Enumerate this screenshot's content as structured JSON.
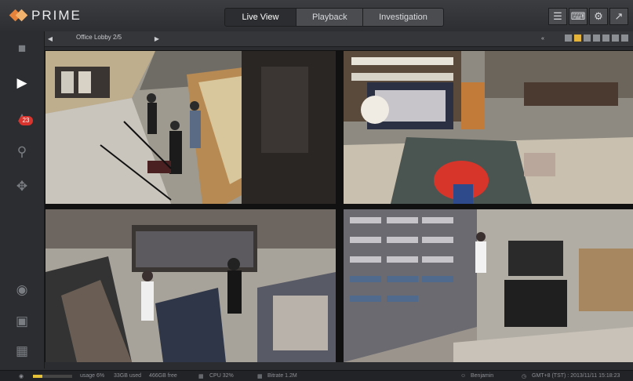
{
  "app": {
    "logo_text": "PRIME"
  },
  "tabs": [
    {
      "label": "Live View",
      "active": true
    },
    {
      "label": "Playback",
      "active": false
    },
    {
      "label": "Investigation",
      "active": false
    }
  ],
  "top_icons": [
    "menu-icon",
    "keyboard-icon",
    "gear-icon",
    "expand-icon"
  ],
  "sidebar": [
    {
      "name": "folder-icon"
    },
    {
      "name": "live-camera-icon",
      "active": true
    },
    {
      "name": "alarm-icon",
      "badge": "23"
    },
    {
      "name": "search-icon"
    },
    {
      "name": "ptz-icon"
    },
    {
      "name": "record-icon"
    },
    {
      "name": "snapshot-icon"
    },
    {
      "name": "save-icon"
    }
  ],
  "subbar": {
    "camera_group": "Office Lobby  2/5"
  },
  "layouts": {
    "selected_index": 1,
    "count": 7
  },
  "status": {
    "usage": "usage 6%",
    "used": "33GB used",
    "free": "466GB free",
    "cpu": "CPU 32%",
    "bitrate": "Bitrate 1.2M",
    "user": "Benjamin",
    "timezone": "GMT+8 (TST) : 2013/11/11 15:18:23",
    "usage_percent": 6
  },
  "colors": {
    "accent": "#e6823a",
    "badge": "#d9352e",
    "layout_active": "#e3b33a"
  }
}
